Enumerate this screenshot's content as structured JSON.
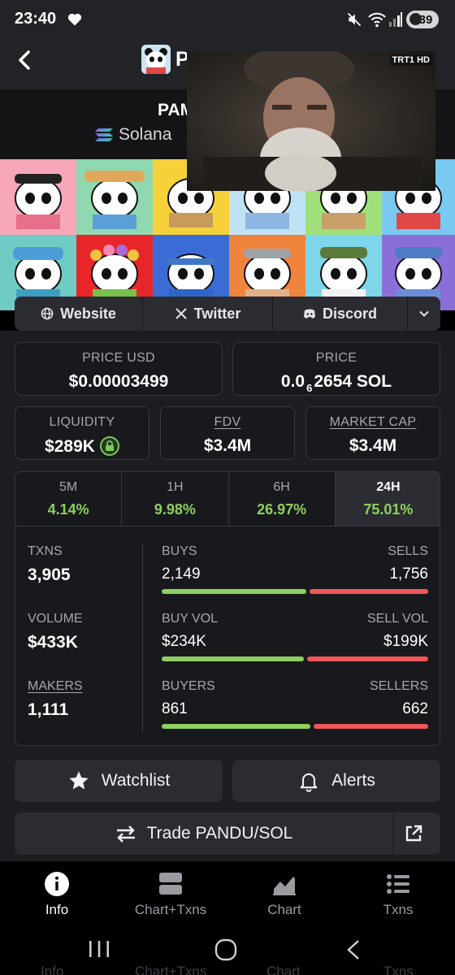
{
  "status_bar": {
    "time": "23:40",
    "battery": "39"
  },
  "header": {
    "name_visible": "P"
  },
  "token": {
    "pair_visible": "PAM",
    "chain": "Solana"
  },
  "video": {
    "logo": "TRT1 HD"
  },
  "links": {
    "website": "Website",
    "twitter": "Twitter",
    "discord": "Discord"
  },
  "price_usd": {
    "label": "PRICE USD",
    "value": "$0.00003499"
  },
  "price": {
    "label": "PRICE",
    "value_main": "0.0",
    "value_sub": "6",
    "value_rest": "2654 SOL"
  },
  "liquidity": {
    "label": "LIQUIDITY",
    "value": "$289K"
  },
  "fdv": {
    "label": "FDV",
    "value": "$3.4M"
  },
  "market_cap": {
    "label": "MARKET CAP",
    "value": "$3.4M"
  },
  "tabs": [
    {
      "label": "5M",
      "value": "4.14%"
    },
    {
      "label": "1H",
      "value": "9.98%"
    },
    {
      "label": "6H",
      "value": "26.97%"
    },
    {
      "label": "24H",
      "value": "75.01%",
      "active": true
    }
  ],
  "stats": {
    "txns": {
      "label": "TXNS",
      "value": "3,905"
    },
    "volume": {
      "label": "VOLUME",
      "value": "$433K"
    },
    "makers": {
      "label": "MAKERS",
      "value": "1,111"
    },
    "buys": {
      "label": "BUYS",
      "value": "2,149",
      "buy_share": 0.55
    },
    "sells": {
      "label": "SELLS",
      "value": "1,756"
    },
    "buy_vol": {
      "label": "BUY VOL",
      "value": "$234K",
      "buy_share": 0.54
    },
    "sell_vol": {
      "label": "SELL VOL",
      "value": "$199K"
    },
    "buyers": {
      "label": "BUYERS",
      "value": "861",
      "buy_share": 0.565
    },
    "sellers": {
      "label": "SELLERS",
      "value": "662"
    }
  },
  "actions": {
    "watchlist": "Watchlist",
    "alerts": "Alerts",
    "trade": "Trade PANDU/SOL"
  },
  "bottom_nav": [
    {
      "label": "Info",
      "icon": "info-icon",
      "active": true
    },
    {
      "label": "Chart+Txns",
      "icon": "chart-txns-icon"
    },
    {
      "label": "Chart",
      "icon": "chart-icon"
    },
    {
      "label": "Txns",
      "icon": "list-icon"
    }
  ],
  "ghost_nav": [
    "Info",
    "Chart+Txns",
    "Chart",
    "Txns"
  ],
  "colors": {
    "positive": "#8ecf5f",
    "negative": "#f0575a",
    "panel": "#1c1d21"
  }
}
